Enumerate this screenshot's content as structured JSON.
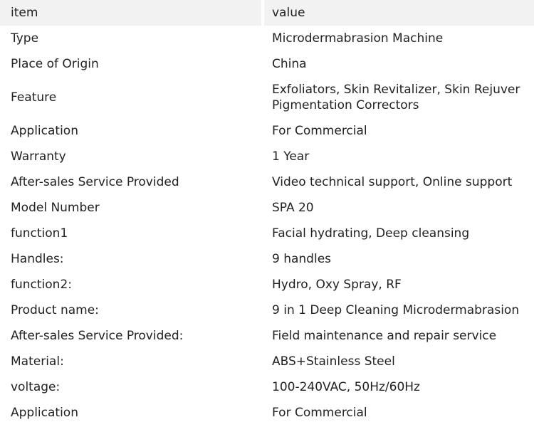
{
  "header": {
    "item": "item",
    "value": "value"
  },
  "rows": [
    {
      "item": "Type",
      "value": [
        "Microdermabrasion Machine"
      ]
    },
    {
      "item": "Place of Origin",
      "value": [
        "China"
      ]
    },
    {
      "item": "Feature",
      "value": [
        "Exfoliators, Skin Revitalizer, Skin Rejuver",
        "Pigmentation Correctors"
      ]
    },
    {
      "item": "Application",
      "value": [
        "For Commercial"
      ]
    },
    {
      "item": "Warranty",
      "value": [
        "1 Year"
      ]
    },
    {
      "item": "After-sales Service Provided",
      "value": [
        "Video technical support, Online support"
      ]
    },
    {
      "item": "Model Number",
      "value": [
        "SPA 20"
      ]
    },
    {
      "item": "function1",
      "value": [
        "Facial hydrating, Deep cleansing"
      ]
    },
    {
      "item": "Handles:",
      "value": [
        "9 handles"
      ]
    },
    {
      "item": "function2:",
      "value": [
        "Hydro, Oxy Spray, RF"
      ]
    },
    {
      "item": "Product name:",
      "value": [
        "9 in 1 Deep Cleaning Microdermabrasion"
      ]
    },
    {
      "item": "After-sales Service Provided:",
      "value": [
        "Field maintenance and repair service"
      ]
    },
    {
      "item": "Material:",
      "value": [
        "ABS+Stainless Steel"
      ]
    },
    {
      "item": "voltage:",
      "value": [
        "100-240VAC, 50Hz/60Hz"
      ]
    },
    {
      "item": "Application",
      "value": [
        "For Commercial"
      ]
    }
  ]
}
